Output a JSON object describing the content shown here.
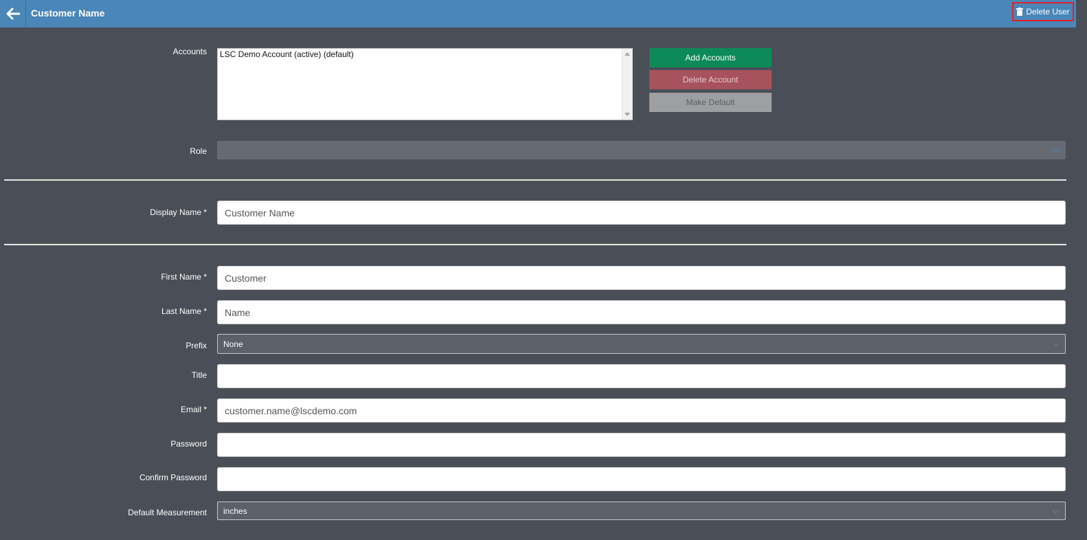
{
  "header": {
    "title": "Customer Name",
    "delete_user_label": "Delete User"
  },
  "accounts": {
    "label": "Accounts",
    "items": [
      "LSC Demo Account (active) (default)"
    ],
    "add_label": "Add Accounts",
    "delete_label": "Delete Account",
    "default_label": "Make Default"
  },
  "role": {
    "label": "Role",
    "value": ""
  },
  "display_name": {
    "label": "Display Name *",
    "value": "Customer Name"
  },
  "first_name": {
    "label": "First Name *",
    "value": "Customer"
  },
  "last_name": {
    "label": "Last Name *",
    "value": "Name"
  },
  "prefix": {
    "label": "Prefix",
    "value": "None"
  },
  "title": {
    "label": "Title",
    "value": ""
  },
  "email": {
    "label": "Email *",
    "value": "customer.name@lscdemo.com"
  },
  "password": {
    "label": "Password",
    "value": ""
  },
  "confirm_password": {
    "label": "Confirm Password",
    "value": ""
  },
  "default_measurement": {
    "label": "Default Measurement",
    "value": "inches"
  },
  "colors": {
    "header": "#4a86b8",
    "background": "#4a4f57",
    "add": "#0d8a59",
    "delete": "#a6535d",
    "highlight": "#e0202a"
  },
  "icons": [
    "arrow-left-icon",
    "trash-icon",
    "chevron-down-icon"
  ]
}
